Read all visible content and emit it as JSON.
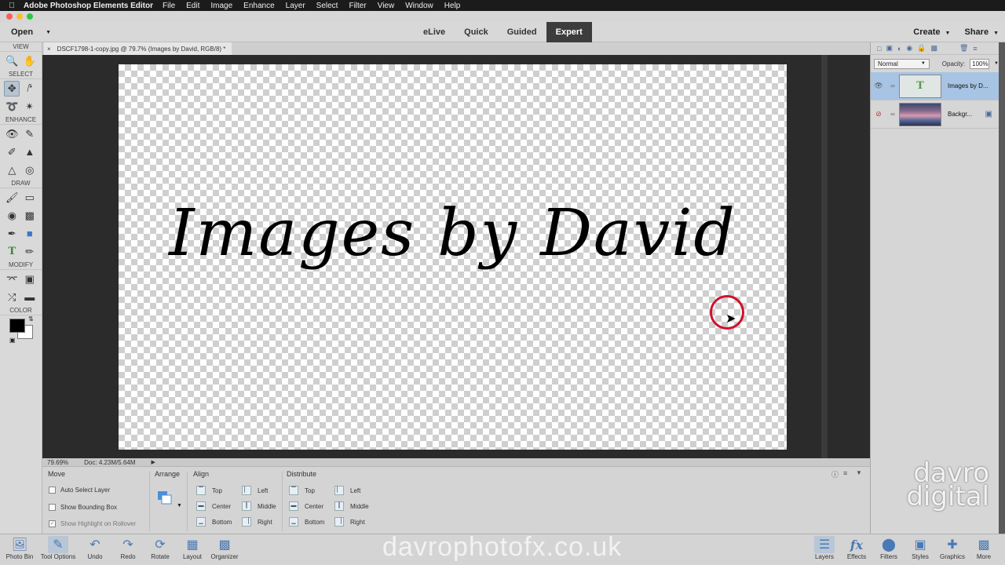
{
  "menubar": {
    "app_name": "Adobe Photoshop Elements Editor",
    "items": [
      "File",
      "Edit",
      "Image",
      "Enhance",
      "Layer",
      "Select",
      "Filter",
      "View",
      "Window",
      "Help"
    ]
  },
  "topbar": {
    "open_label": "Open",
    "modes": [
      {
        "label": "eLive",
        "active": false
      },
      {
        "label": "Quick",
        "active": false
      },
      {
        "label": "Guided",
        "active": false
      },
      {
        "label": "Expert",
        "active": true
      }
    ],
    "create_label": "Create",
    "share_label": "Share"
  },
  "toolbox": {
    "sections": {
      "view": "VIEW",
      "select": "SELECT",
      "enhance": "ENHANCE",
      "draw": "DRAW",
      "modify": "MODIFY",
      "color": "COLOR"
    },
    "foreground_color": "#000000",
    "background_color": "#ffffff"
  },
  "document": {
    "tab_label": "DSCF1798-1-copy.jpg @ 79.7% (Images by David, RGB/8) *",
    "canvas_text": "Images by David",
    "zoom": "79.69%",
    "doc_info": "Doc: 4.23M/5.64M"
  },
  "tool_options": {
    "tool_name": "Move",
    "checks": [
      {
        "label": "Auto Select Layer",
        "checked": false,
        "disabled": false
      },
      {
        "label": "Show Bounding Box",
        "checked": false,
        "disabled": false
      },
      {
        "label": "Show Highlight on Rollover",
        "checked": true,
        "disabled": true
      }
    ],
    "arrange_label": "Arrange",
    "align_label": "Align",
    "align_items": [
      "Top",
      "Center",
      "Bottom",
      "Left",
      "Middle",
      "Right"
    ],
    "distribute_label": "Distribute",
    "distribute_items": [
      "Top",
      "Center",
      "Bottom",
      "Left",
      "Middle",
      "Right"
    ]
  },
  "layers_panel": {
    "blend_mode": "Normal",
    "opacity_label": "Opacity:",
    "opacity_value": "100%",
    "layers": [
      {
        "name": "Images by D...",
        "type": "text",
        "active": true
      },
      {
        "name": "Backgr...",
        "type": "photo",
        "active": false
      }
    ]
  },
  "bottom_bar": {
    "left": [
      {
        "label": "Photo Bin",
        "icon": "photo-bin-icon"
      },
      {
        "label": "Tool Options",
        "icon": "tool-options-icon"
      },
      {
        "label": "Undo",
        "icon": "undo-icon"
      },
      {
        "label": "Redo",
        "icon": "redo-icon"
      },
      {
        "label": "Rotate",
        "icon": "rotate-icon"
      },
      {
        "label": "Layout",
        "icon": "layout-icon"
      },
      {
        "label": "Organizer",
        "icon": "organizer-icon"
      }
    ],
    "right": [
      {
        "label": "Layers",
        "icon": "layers-icon"
      },
      {
        "label": "Effects",
        "icon": "effects-icon"
      },
      {
        "label": "Filters",
        "icon": "filters-icon"
      },
      {
        "label": "Styles",
        "icon": "styles-icon"
      },
      {
        "label": "Graphics",
        "icon": "graphics-icon"
      },
      {
        "label": "More",
        "icon": "more-icon"
      }
    ]
  },
  "overlay": {
    "url_watermark": "davrophotofx.co.uk",
    "brand_line1": "davro",
    "brand_line2": "digital"
  },
  "colors": {
    "accent_active_layer": "#a8c4e4",
    "cursor_ring": "#d0112b",
    "active_mode_bg": "#3c3c3c"
  }
}
